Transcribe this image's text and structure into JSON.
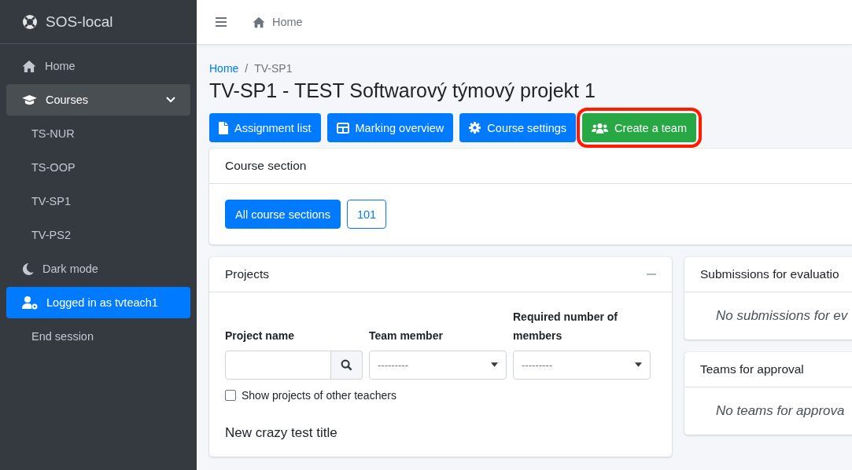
{
  "brand": "SOS-local",
  "sidebar": {
    "items": [
      {
        "label": "Home",
        "kind": "home",
        "selected": false
      },
      {
        "label": "Courses",
        "kind": "courses",
        "selected": false,
        "expanded": true,
        "children": [
          {
            "label": "TS-NUR"
          },
          {
            "label": "TS-OOP"
          },
          {
            "label": "TV-SP1"
          },
          {
            "label": "TV-PS2"
          }
        ]
      },
      {
        "label": "Dark mode",
        "kind": "theme",
        "selected": false
      },
      {
        "label": "Logged in as tvteach1",
        "kind": "user",
        "selected": true
      },
      {
        "label": "End session",
        "kind": "plain",
        "selected": false
      }
    ]
  },
  "topbar": {
    "home": "Home"
  },
  "breadcrumb": [
    "Home",
    "TV-SP1"
  ],
  "breadcrumb_separator": "/",
  "title": "TV-SP1 - TEST Softwarový týmový projekt 1",
  "actions": [
    {
      "label": "Assignment list",
      "kind": "file",
      "color": "#007bff",
      "highlighted": false
    },
    {
      "label": "Marking overview",
      "kind": "table",
      "color": "#007bff",
      "highlighted": false
    },
    {
      "label": "Course settings",
      "kind": "gear",
      "color": "#007bff",
      "highlighted": false
    },
    {
      "label": "Create a team",
      "kind": "users",
      "color": "#28a745",
      "highlighted": true
    }
  ],
  "course_section": {
    "title": "Course section",
    "options": [
      {
        "label": "All course sections",
        "selected": true
      },
      {
        "label": "101",
        "selected": false
      }
    ]
  },
  "projects": {
    "title": "Projects",
    "filters": [
      {
        "label": "Project name",
        "kind": "search"
      },
      {
        "label": "Team member",
        "kind": "select",
        "value": "---------"
      },
      {
        "label": "Required number of members",
        "kind": "select",
        "value": "---------"
      }
    ],
    "checkbox": {
      "label": "Show projects of other teachers",
      "checked": false
    },
    "items": [
      "New crazy test title"
    ]
  },
  "side_cards": [
    {
      "title": "Submissions for evaluatio",
      "empty": "No submissions for ev"
    },
    {
      "title": "Teams for approval",
      "empty": "No teams for approva"
    }
  ]
}
